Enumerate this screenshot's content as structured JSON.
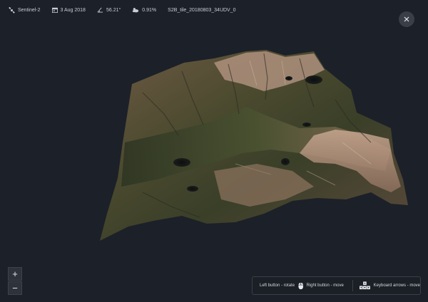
{
  "topbar": {
    "satellite": "Sentinel-2",
    "date": "3 Aug 2018",
    "sun_angle": "56.21°",
    "cloud_cover": "0.91%",
    "tile": "S2B_tile_20180803_34UDV_0"
  },
  "zoom": {
    "in_label": "+",
    "out_label": "−"
  },
  "controls": {
    "left_button": "Left button - rotate",
    "right_button": "Right button - move",
    "keyboard": "Keyboard arrows - move"
  },
  "colors": {
    "background": "#1c2028",
    "text": "#c9ced6",
    "panel": "#1b1f26",
    "button": "#3a3f47"
  },
  "icons": {
    "satellite": "satellite-icon",
    "date": "calendar-icon",
    "sun_angle": "angle-icon",
    "cloud_cover": "cloud-icon",
    "close": "close-icon",
    "mouse": "mouse-icon",
    "keyboard": "keyboard-arrows-icon"
  }
}
